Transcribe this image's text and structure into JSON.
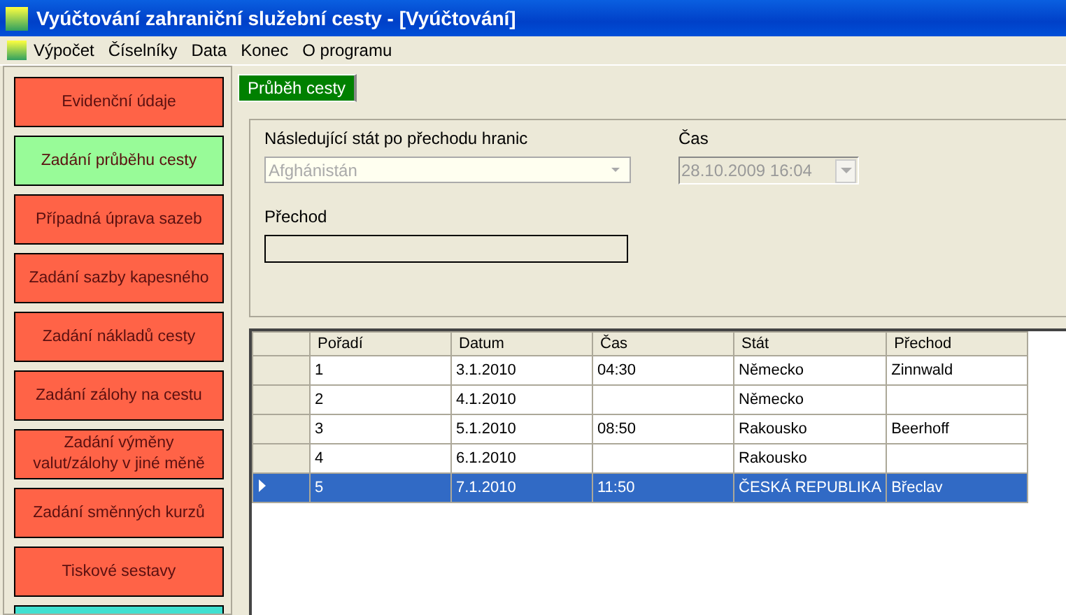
{
  "window": {
    "title": "Vyúčtování zahraniční služební cesty - [Vyúčtování]"
  },
  "menu": [
    "Výpočet",
    "Číselníky",
    "Data",
    "Konec",
    "O programu"
  ],
  "sidebar": {
    "items": [
      {
        "label": "Evidenční údaje",
        "color": "#ff6347"
      },
      {
        "label": "Zadání průběhu cesty",
        "color": "#98fb98"
      },
      {
        "label": "Případná úprava sazeb",
        "color": "#ff6347"
      },
      {
        "label": "Zadání sazby kapesného",
        "color": "#ff6347"
      },
      {
        "label": "Zadání nákladů cesty",
        "color": "#ff6347"
      },
      {
        "label": "Zadání zálohy na cestu",
        "color": "#ff6347"
      },
      {
        "label": "Zadání výměny valut/zálohy v jiné měně",
        "color": "#ff6347"
      },
      {
        "label": "Zadání směnných kurzů",
        "color": "#ff6347"
      },
      {
        "label": "Tiskové sestavy",
        "color": "#ff6347"
      },
      {
        "color": "#40e0d0"
      }
    ]
  },
  "tabs": [
    {
      "label": "Průběh cesty",
      "selected": true
    }
  ],
  "form": {
    "country_label": "Následující stát po přechodu hranic",
    "country_value": "Afghánistán",
    "time_label": "Čas",
    "time_value": "28.10.2009 16:04",
    "crossing_label": "Přechod",
    "disabled": true
  },
  "table": {
    "columns": [
      "Pořadí",
      "Datum",
      "Čas",
      "Stát",
      "Přechod"
    ],
    "rows": [
      {
        "cells": [
          "1",
          "3.1.2010",
          "04:30",
          "Německo",
          "Zinnwald"
        ],
        "selected": false
      },
      {
        "cells": [
          "2",
          "4.1.2010",
          "",
          "Německo",
          ""
        ],
        "selected": false
      },
      {
        "cells": [
          "3",
          "5.1.2010",
          "08:50",
          "Rakousko",
          "Beerhoff"
        ],
        "selected": false
      },
      {
        "cells": [
          "4",
          "6.1.2010",
          "",
          "Rakousko",
          ""
        ],
        "selected": false
      },
      {
        "cells": [
          "5",
          "7.1.2010",
          "11:50",
          "ČESKÁ REPUBLIKA",
          "Břeclav"
        ],
        "selected": true
      }
    ]
  }
}
